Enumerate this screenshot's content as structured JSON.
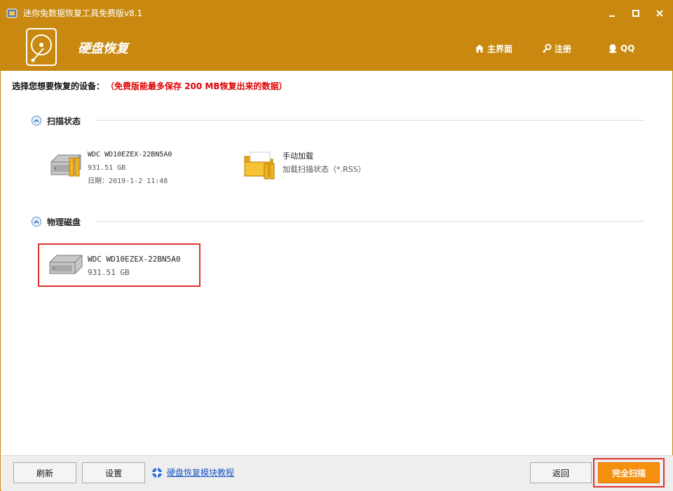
{
  "window": {
    "title": "迷你兔数据恢复工具免费版v8.1"
  },
  "header": {
    "title": "硬盘恢复",
    "nav": {
      "home": "主界面",
      "register": "注册",
      "qq": "QQ"
    }
  },
  "prompt": {
    "label": "选择您想要恢复的设备：",
    "warning": "（免费版能最多保存 200 MB恢复出来的数据）"
  },
  "sections": {
    "scan_status": {
      "title": "扫描状态",
      "items": [
        {
          "name": "WDC WD10EZEX-22BN5A0",
          "size": "931.51 GB",
          "date": "日期：2019-1-2 11:48"
        },
        {
          "name": "手动加载",
          "desc": "加载扫描状态（*.RSS）"
        }
      ]
    },
    "physical_disk": {
      "title": "物理磁盘",
      "items": [
        {
          "name": "WDC WD10EZEX-22BN5A0",
          "size": "931.51 GB"
        }
      ]
    }
  },
  "footer": {
    "refresh": "刷新",
    "settings": "设置",
    "help_link": "硬盘恢复模块教程",
    "back": "返回",
    "full_scan": "完全扫描"
  },
  "colors": {
    "titlebar": "#c98910",
    "scan_button": "#f5900e",
    "highlight": "#e0322f",
    "warning_text": "#e00000",
    "link": "#1a57c8"
  },
  "icons": {
    "app": "app-icon",
    "logo": "hdd-logo-icon",
    "home": "home-icon",
    "register": "key-icon",
    "qq": "qq-penguin-icon",
    "collapse": "chevron-up-icon",
    "disk": "hard-disk-icon",
    "folder": "folder-icon",
    "help": "lifebuoy-icon"
  }
}
